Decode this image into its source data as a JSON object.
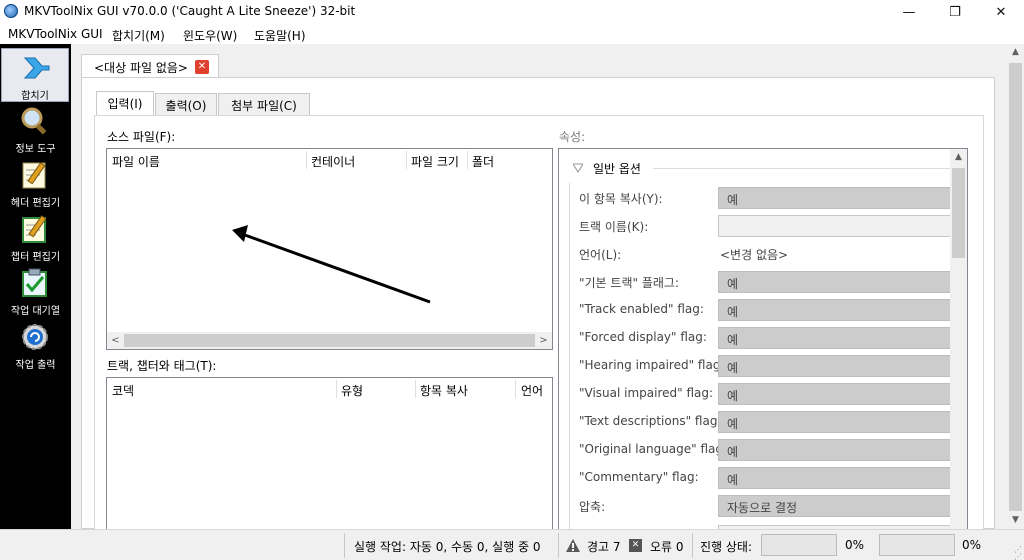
{
  "window": {
    "title": "MKVToolNix GUI v70.0.0 ('Caught A Lite Sneeze') 32-bit",
    "minimize": "—",
    "maximize": "❐",
    "close": "✕"
  },
  "menu": [
    "MKVToolNix GUI",
    "합치기(M)",
    "윈도우(W)",
    "도움말(H)"
  ],
  "sidebar": [
    {
      "label": "합치기",
      "icon": "merge-arrow-icon",
      "active": true
    },
    {
      "label": "정보 도구",
      "icon": "magnifier-icon",
      "active": false
    },
    {
      "label": "헤더 편집기",
      "icon": "pencil-note-icon",
      "active": false
    },
    {
      "label": "챕터 편집기",
      "icon": "chapter-note-icon",
      "active": false
    },
    {
      "label": "작업 대기열",
      "icon": "checklist-icon",
      "active": false
    },
    {
      "label": "작업 출력",
      "icon": "gear-output-icon",
      "active": false
    }
  ],
  "doc_tab": {
    "label": "<대상 파일 없음>",
    "close": "✕"
  },
  "sub_tabs": [
    "입력(I)",
    "출력(O)",
    "첨부 파일(C)"
  ],
  "source": {
    "label": "소스 파일(F):",
    "columns": [
      "파일 이름",
      "컨테이너",
      "파일 크기",
      "폴더"
    ]
  },
  "tracks": {
    "label": "트랙, 챕터와 태그(T):",
    "columns": [
      "코덱",
      "유형",
      "항목 복사",
      "언어"
    ]
  },
  "properties": {
    "label": "속성:",
    "group": "일반 옵션",
    "rows": [
      {
        "label": "이 항목 복사(Y):",
        "value": "예",
        "kind": "combo"
      },
      {
        "label": "트랙 이름(K):",
        "value": "",
        "kind": "input"
      },
      {
        "label": "언어(L):",
        "value": "<변경 없음>",
        "kind": "plain"
      },
      {
        "label": "\"기본 트랙\" 플래그:",
        "value": "예",
        "kind": "combo"
      },
      {
        "label": "\"Track enabled\" flag:",
        "value": "예",
        "kind": "combo"
      },
      {
        "label": "\"Forced display\" flag:",
        "value": "예",
        "kind": "combo"
      },
      {
        "label": "\"Hearing impaired\" flag:",
        "value": "예",
        "kind": "combo"
      },
      {
        "label": "\"Visual impaired\" flag:",
        "value": "예",
        "kind": "combo"
      },
      {
        "label": "\"Text descriptions\" flag:",
        "value": "예",
        "kind": "combo"
      },
      {
        "label": "\"Original language\" flag:",
        "value": "예",
        "kind": "combo"
      },
      {
        "label": "\"Commentary\" flag:",
        "value": "예",
        "kind": "combo"
      },
      {
        "label": "압축:",
        "value": "자동으로 결정",
        "kind": "combo"
      }
    ]
  },
  "status": {
    "jobs": "실행 작업: 자동 0, 수동 0, 실행 중 0",
    "warnings": "경고 7",
    "errors": "오류 0",
    "progress_label": "진행 상태:",
    "progress1": "0%",
    "progress2": "0%"
  }
}
